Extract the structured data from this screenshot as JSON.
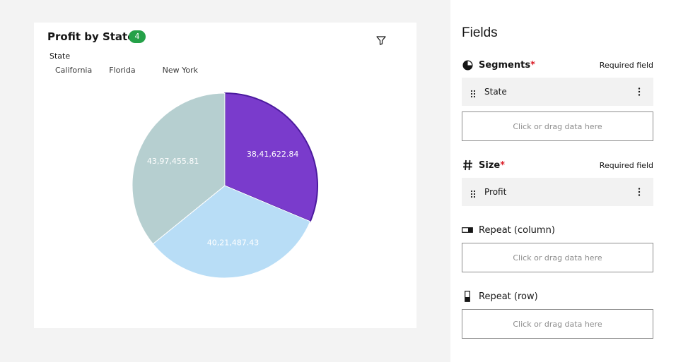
{
  "card": {
    "title": "Profit by State",
    "badge": "4",
    "filter_icon": "filter-icon"
  },
  "legend": {
    "title": "State",
    "items": [
      "California",
      "Florida",
      "New York"
    ]
  },
  "chart_data": {
    "type": "pie",
    "title": "Profit by State",
    "slices": [
      {
        "label": "38,41,622.84",
        "value": 3841622.84,
        "color": "#7a3bcc"
      },
      {
        "label": "40,21,487.43",
        "value": 4021487.43,
        "color": "#b8ddf6"
      },
      {
        "label": "43,97,455.81",
        "value": 4397455.81,
        "color": "#b6cfd0"
      }
    ]
  },
  "panel": {
    "title": "Fields",
    "segments": {
      "label": "Segments",
      "required_mark": "*",
      "required_text": "Required field",
      "field": "State",
      "drop_text": "Click or drag data here",
      "icon": "pie-segment-icon"
    },
    "size": {
      "label": "Size",
      "required_mark": "*",
      "required_text": "Required field",
      "field": "Profit",
      "icon": "hash-icon"
    },
    "repeat_column": {
      "label": "Repeat (column)",
      "drop_text": "Click or drag data here",
      "icon": "repeat-column-icon"
    },
    "repeat_row": {
      "label": "Repeat (row)",
      "drop_text": "Click or drag data here",
      "icon": "repeat-row-icon"
    }
  }
}
